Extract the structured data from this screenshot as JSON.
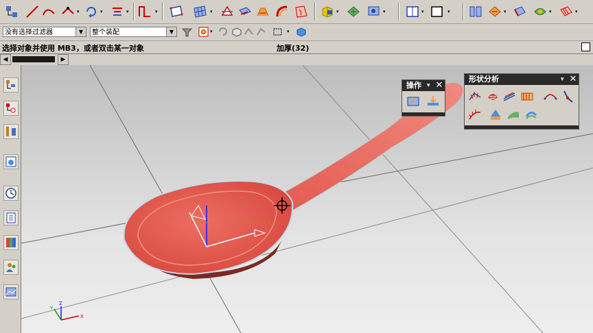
{
  "toolbar": {
    "icons": [
      "sketch-icon",
      "line-icon",
      "arc-icon",
      "point-icon",
      "rotate-icon",
      "offset-icon",
      "curve-tools-icon",
      "surface-icon",
      "mesh-surface-icon",
      "trim-icon",
      "extract-icon",
      "bridge-icon",
      "thicken-icon",
      "face-icon",
      "view-icon",
      "section-icon",
      "display-icon",
      "layer-icon",
      "shade-icon",
      "analysis-icon",
      "render-icon"
    ]
  },
  "filters": {
    "type_filter": "没有选择过滤器",
    "scope": "整个装配"
  },
  "status": {
    "message": "选择对象并使用 MB3，或者双击某一对象",
    "operation": "加厚(32)"
  },
  "palettes": {
    "operation": {
      "title": "操作",
      "buttons": [
        "edit-parameters-icon",
        "update-icon"
      ]
    },
    "shape_analysis": {
      "title": "形状分析",
      "buttons": [
        "face-curvature-icon",
        "reflection-icon",
        "section-analysis-icon",
        "gap-analysis-icon",
        "curve-analysis-icon",
        "radius-icon",
        "comb-icon",
        "draft-analysis-icon",
        "slope-icon",
        "hue-icon"
      ]
    }
  },
  "sidebar": {
    "icons": [
      "part-navigator-icon",
      "assembly-navigator-icon",
      "constraint-navigator-icon",
      "reuse-library-icon",
      "history-icon",
      "system-materials-icon",
      "colors-icon",
      "roles-icon",
      "template-icon"
    ]
  },
  "wcs_axes": {
    "x": "X",
    "y": "Y",
    "z": "Z"
  },
  "colors": {
    "model": "#e86a5e",
    "model_shadow": "#7a2a22",
    "viewport_top": "#bdbdbd",
    "viewport_bottom": "#eeeeee"
  }
}
